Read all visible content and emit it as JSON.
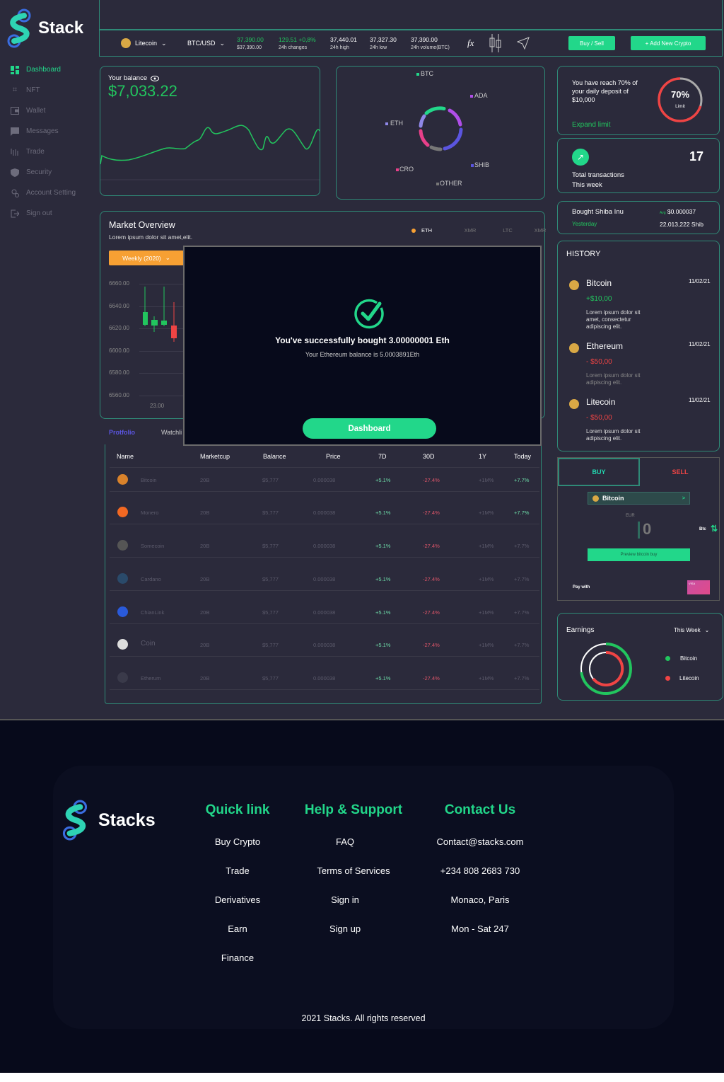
{
  "brand": {
    "name": "Stack",
    "footer_name": "Stacks"
  },
  "colors": {
    "accent": "#22d78a",
    "positive": "#22c55e",
    "negative": "#ef4444",
    "orange": "#f7a033",
    "bg": "#2b2a3b",
    "modal_bg": "#070a1b"
  },
  "sidebar": {
    "items": [
      {
        "label": "Dashboard",
        "icon": "dashboard-icon",
        "active": true
      },
      {
        "label": "NFT",
        "icon": "nft-icon"
      },
      {
        "label": "Wallet",
        "icon": "wallet-icon"
      },
      {
        "label": "Messages",
        "icon": "messages-icon"
      },
      {
        "label": "Trade",
        "icon": "trade-icon"
      },
      {
        "label": "Security",
        "icon": "shield-icon"
      },
      {
        "label": "Account Setting",
        "icon": "account-icon"
      },
      {
        "label": "Sign out",
        "icon": "sign-out-icon"
      }
    ]
  },
  "topbar": {
    "coin_select": "Litecoin",
    "pair_select": "BTC/USD",
    "price": "37,390.00",
    "price_usd": "$37,390.00",
    "change_value": "129.51",
    "change_pct": "+0,8%",
    "change_label": "24h changes",
    "high": "37,440.01",
    "high_label": "24h high",
    "low": "37,327.30",
    "low_label": "24h low",
    "volume": "37,390.00",
    "volume_label": "24h volume(BTC)",
    "fx_label": "fx",
    "buy_sell_label": "Buy / Sell",
    "add_crypto_label": "+ Add New Crypto"
  },
  "balance": {
    "label": "Your balance",
    "value": "$7,033.22"
  },
  "allocation": {
    "legend": [
      {
        "name": "BTC",
        "color": "#22d78a"
      },
      {
        "name": "ADA",
        "color": "#b04ee8"
      },
      {
        "name": "ETH",
        "color": "#8f88e8"
      },
      {
        "name": "SHIB",
        "color": "#5b55e0"
      },
      {
        "name": "CRO",
        "color": "#e8408a"
      },
      {
        "name": "OTHER",
        "color": "#777777"
      }
    ]
  },
  "limit": {
    "text": "You have reach 70% of your daily deposit of $10,000",
    "link": "Expand limit",
    "percent_label": "70%",
    "percent": 70,
    "sub": "Limit"
  },
  "transactions": {
    "count": "17",
    "label1": "Total transactions",
    "label2": "This week"
  },
  "shiba": {
    "title": "Bought Shiba Inu",
    "when": "Yesterday",
    "avg_label": "Avg",
    "avg_value": "$0.000037",
    "amount": "22,013,222 Shib"
  },
  "market": {
    "title": "Market Overview",
    "subtitle": "Lorem ipsum dolor sit amet,elit.",
    "period": "Weekly (2020)",
    "tabs": [
      "ETH",
      "XMR",
      "LTC",
      "XMR"
    ],
    "yticks": [
      "6660.00",
      "6640.00",
      "6620.00",
      "6600.00",
      "6580.00",
      "6560.00"
    ],
    "xticks": [
      "23.00"
    ]
  },
  "portfolio_tabs": [
    "Protfolio",
    "Watchli"
  ],
  "modal": {
    "title": "You've successfully bought 3.00000001 Eth",
    "subtitle": "Your Ethereum balance is 5.0003891Eth",
    "button": "Dashboard"
  },
  "table": {
    "headers": [
      "Name",
      "Marketcup",
      "Balance",
      "Price",
      "7D",
      "30D",
      "1Y",
      "Today"
    ],
    "rows": [
      {
        "name": "Bitcoin",
        "icon": "bitcoin-icon",
        "cap": "20B",
        "balance": "$5,777",
        "price": "0.000038",
        "d7": "+5.1%",
        "d30": "-27.4%",
        "y1": "+1M%",
        "today": "+7.7%"
      },
      {
        "name": "Monero",
        "icon": "monero-icon",
        "cap": "20B",
        "balance": "$5,777",
        "price": "0.000038",
        "d7": "+5.1%",
        "d30": "-27.4%",
        "y1": "+1M%",
        "today": "+7.7%"
      },
      {
        "name": "Somecoin",
        "icon": "somecoin-icon",
        "cap": "20B",
        "balance": "$5,777",
        "price": "0.000038",
        "d7": "+5.1%",
        "d30": "-27.4%",
        "y1": "+1M%",
        "today": "+7.7%"
      },
      {
        "name": "Cardano",
        "icon": "cardano-icon",
        "cap": "20B",
        "balance": "$5,777",
        "price": "0.000038",
        "d7": "+5.1%",
        "d30": "-27.4%",
        "y1": "+1M%",
        "today": "+7.7%"
      },
      {
        "name": "ChianLink",
        "icon": "chainlink-icon",
        "cap": "20B",
        "balance": "$5,777",
        "price": "0.000038",
        "d7": "+5.1%",
        "d30": "-27.4%",
        "y1": "+1M%",
        "today": "+7.7%"
      },
      {
        "name": "Coin",
        "icon": "coin-icon",
        "cap": "20B",
        "balance": "$5,777",
        "price": "0.000038",
        "d7": "+5.1%",
        "d30": "-27.4%",
        "y1": "+1M%",
        "today": "+7.7%"
      },
      {
        "name": "Etherum",
        "icon": "ethereum-icon",
        "cap": "20B",
        "balance": "$5,777",
        "price": "0.000038",
        "d7": "+5.1%",
        "d30": "-27.4%",
        "y1": "+1M%",
        "today": "+7.7%"
      }
    ]
  },
  "history": {
    "title": "HISTORY",
    "items": [
      {
        "coin": "Bitcoin",
        "date": "11/02/21",
        "amount": "+$10,00",
        "desc": "Lorem ipsum dolor sit amet, consectetur adipiscing elit.",
        "positive": true
      },
      {
        "coin": "Ethereum",
        "date": "11/02/21",
        "amount": "- $50,00",
        "desc": "Lorem ipsum dolor sit adipiscing elit.",
        "positive": false
      },
      {
        "coin": "Litecoin",
        "date": "11/02/21",
        "amount": "- $50,00",
        "desc": "Lorem ipsum dolor sit adipiscing elit.",
        "positive": false
      }
    ]
  },
  "trade": {
    "buy": "BUY",
    "sell": "SELL",
    "coin": "Bitcoin",
    "currency": "EUR",
    "amount": "0",
    "unit": "Btc",
    "preview": "Preview bitcoin buy",
    "pay_with": "Pay with",
    "card_label": "VISA"
  },
  "earnings": {
    "title": "Earnings",
    "period": "This Week",
    "legend": [
      {
        "name": "Bitcoin",
        "color": "#22c55e"
      },
      {
        "name": "Litecoin",
        "color": "#ef4444"
      }
    ]
  },
  "footer": {
    "columns": [
      {
        "title": "Quick link",
        "links": [
          "Buy Crypto",
          "Trade",
          "Derivatives",
          "Earn",
          "Finance"
        ]
      },
      {
        "title": "Help & Support",
        "links": [
          "FAQ",
          "Terms of Services",
          "Sign in",
          "Sign up"
        ]
      },
      {
        "title": "Contact Us",
        "links": [
          "Contact@stacks.com",
          "+234 808 2683 730",
          "Monaco, Paris",
          "Mon - Sat 247"
        ]
      }
    ],
    "copyright": "2021 Stacks. All rights reserved"
  }
}
